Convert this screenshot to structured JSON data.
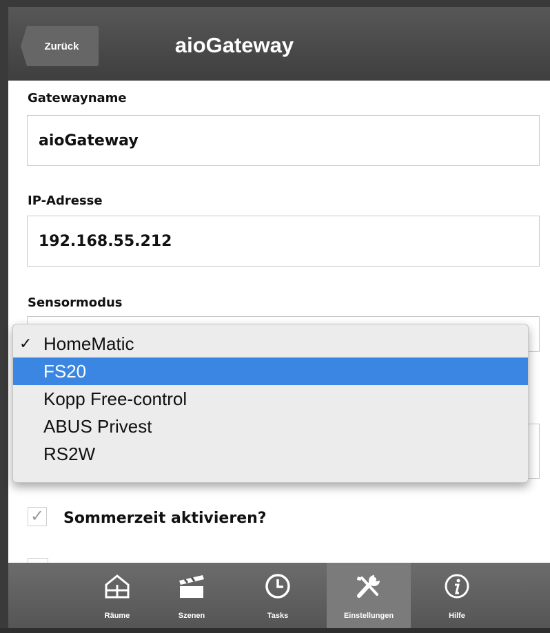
{
  "header": {
    "back_label": "Zurück",
    "title": "aioGateway"
  },
  "form": {
    "gatewayname_label": "Gatewayname",
    "gatewayname_value": "aioGateway",
    "ip_label": "IP-Adresse",
    "ip_value": "192.168.55.212",
    "sensormode_label": "Sensormodus"
  },
  "dropdown": {
    "checked": "✓",
    "options": [
      "HomeMatic",
      "FS20",
      "Kopp Free-control",
      "ABUS Privest",
      "RS2W"
    ],
    "checked_index": 0,
    "highlighted_index": 1,
    "highlight_color": "#3a86e2"
  },
  "checkbox": {
    "mark": "✓",
    "label": "Sommerzeit aktivieren?"
  },
  "tabs": [
    {
      "label": "Räume",
      "icon": "house-icon"
    },
    {
      "label": "Szenen",
      "icon": "clapperboard-icon"
    },
    {
      "label": "Tasks",
      "icon": "clock-icon"
    },
    {
      "label": "Einstellungen",
      "icon": "tools-icon",
      "active": true
    },
    {
      "label": "Hilfe",
      "icon": "info-icon"
    }
  ]
}
